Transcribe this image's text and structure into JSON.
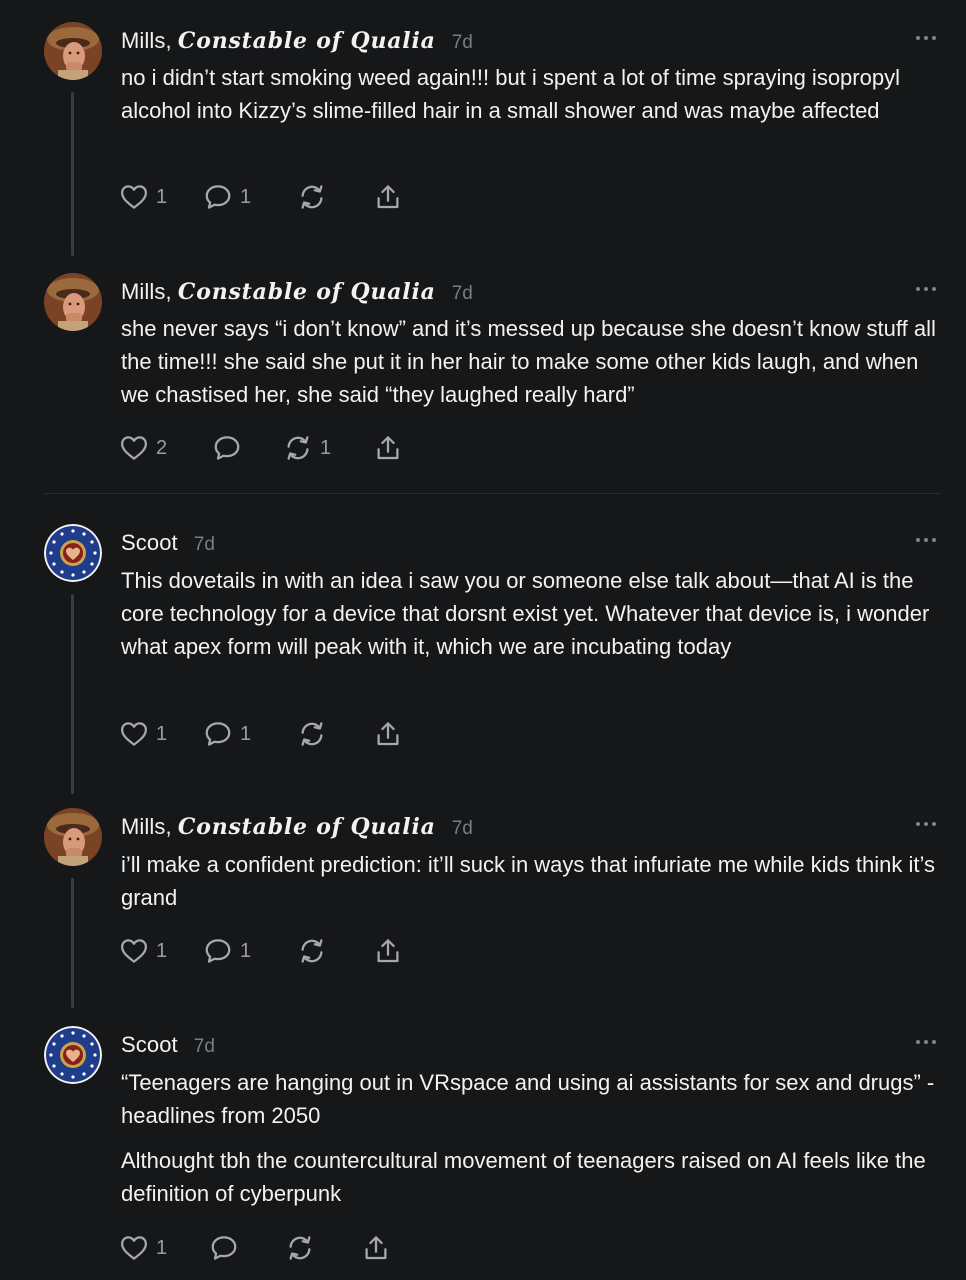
{
  "posts": [
    {
      "author": "Mills, ",
      "author_styled": "Constable of Qualia",
      "time": "7d",
      "paragraphs": [
        "no i didn’t start smoking weed again!!! but i spent a lot of time spraying isopropyl alcohol into Kizzy’s slime-filled hair in a small shower and was maybe affected"
      ],
      "likes": "1",
      "comments": "1",
      "restacks": ""
    },
    {
      "author": "Mills, ",
      "author_styled": "Constable of Qualia",
      "time": "7d",
      "paragraphs": [
        "she never says “i don’t know” and it’s messed up because she doesn’t know stuff all the time!!! she said she put it in her hair to make some other kids laugh, and when we chastised her, she said “they laughed really hard”"
      ],
      "likes": "2",
      "comments": "",
      "restacks": "1"
    },
    {
      "author": "Scoot",
      "author_styled": "",
      "time": "7d",
      "paragraphs": [
        "This dovetails in with an idea i saw you or someone else talk about—that AI is the core technology for a device that dorsnt exist yet. Whatever that device is, i wonder what apex form will peak with it, which we are incubating today"
      ],
      "likes": "1",
      "comments": "1",
      "restacks": ""
    },
    {
      "author": "Mills, ",
      "author_styled": "Constable of Qualia",
      "time": "7d",
      "paragraphs": [
        "i’ll make a confident prediction: it’ll suck in ways that infuriate me while kids think it’s grand"
      ],
      "likes": "1",
      "comments": "1",
      "restacks": ""
    },
    {
      "author": "Scoot",
      "author_styled": "",
      "time": "7d",
      "paragraphs": [
        "“Teenagers are hanging out in VRspace and using ai assistants for sex and drugs” - headlines from 2050",
        "Althought tbh the countercultural movement of teenagers raised on AI feels like the definition of cyberpunk"
      ],
      "likes": "1",
      "comments": "",
      "restacks": ""
    }
  ],
  "icons": {
    "more": "more-options-icon",
    "like": "heart-icon",
    "comment": "comment-icon",
    "restack": "restack-icon",
    "share": "share-icon"
  },
  "colors": {
    "background": "#161719",
    "text": "#f2f2f2",
    "muted": "#7b7d82",
    "icon": "#a6a8ad",
    "thread_line": "#3a3b3e"
  }
}
